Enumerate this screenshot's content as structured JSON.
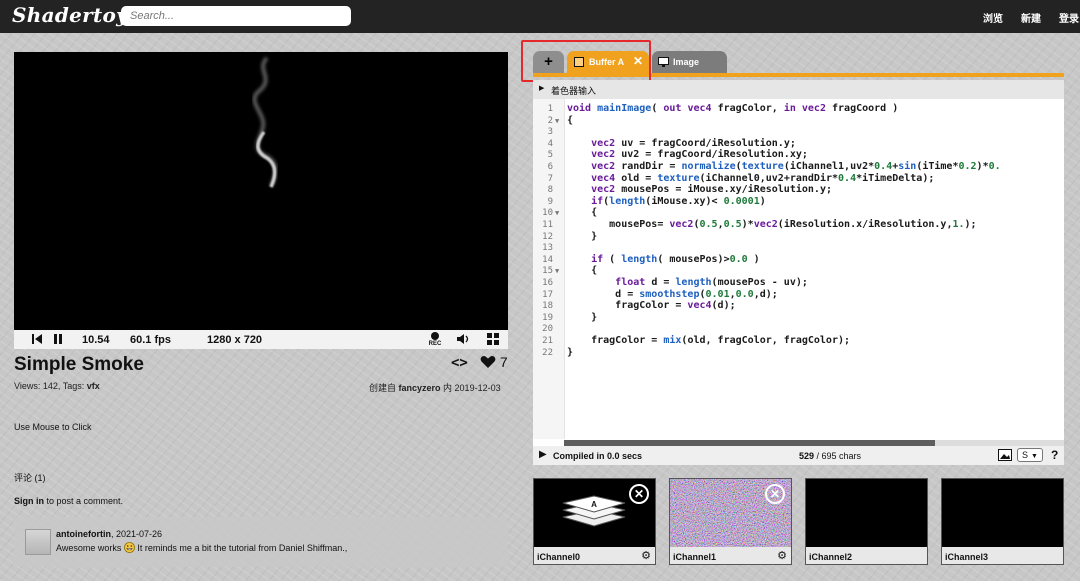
{
  "header": {
    "logo": "Shadertoy",
    "search_placeholder": "Search...",
    "nav": [
      "浏览",
      "新建",
      "登录"
    ]
  },
  "player": {
    "time": "10.54",
    "fps": "60.1 fps",
    "resolution": "1280 x 720",
    "rec_label": "REC"
  },
  "shader": {
    "title": "Simple Smoke",
    "views_text": "Views: 142, Tags: ",
    "tag": "vfx",
    "likes": "7",
    "created_prefix": "创建自 ",
    "author": "fancyzero",
    "created_suffix": " 内 2019-12-03",
    "description": "Use Mouse to Click"
  },
  "comments": {
    "header": "评论 (1)",
    "signin_link": "Sign in",
    "signin_text": " to post a comment.",
    "items": [
      {
        "user": "antoinefortin",
        "date": ", 2021-07-26",
        "text_before": "Awesome works ",
        "text_after": " It reminds me a bit the tutorial from Daniel Shiffman.,"
      }
    ]
  },
  "editor": {
    "tabs": [
      {
        "label": "+"
      },
      {
        "label": "Buffer A"
      },
      {
        "label": "Image"
      }
    ],
    "input_header": "着色器输入",
    "status": {
      "compiled": "Compiled in 0.0 secs",
      "chars_count": "529",
      "chars_total": " / 695 chars",
      "select_value": "S",
      "help": "?"
    }
  },
  "code_lines": [
    "void mainImage( out vec4 fragColor, in vec2 fragCoord )",
    "{",
    "",
    "    vec2 uv = fragCoord/iResolution.y;",
    "    vec2 uv2 = fragCoord/iResolution.xy;",
    "    vec2 randDir = normalize(texture(iChannel1,uv2*0.4+sin(iTime*0.2)*0.",
    "    vec4 old = texture(iChannel0,uv2+randDir*0.4*iTimeDelta);",
    "    vec2 mousePos = iMouse.xy/iResolution.y;",
    "    if(length(iMouse.xy)< 0.0001)",
    "    {",
    "       mousePos= vec2(0.5,0.5)*vec2(iResolution.x/iResolution.y,1.);",
    "    }",
    "",
    "    if ( length( mousePos)>0.0 )",
    "    {",
    "        float d = length(mousePos - uv);",
    "        d = smoothstep(0.01,0.0,d);",
    "        fragColor = vec4(d);",
    "    }",
    "",
    "    fragColor = mix(old, fragColor, fragColor);",
    "}"
  ],
  "channels": [
    {
      "label": "iChannel0"
    },
    {
      "label": "iChannel1"
    },
    {
      "label": "iChannel2"
    },
    {
      "label": "iChannel3"
    }
  ],
  "colors": {
    "accent": "#f0a11d",
    "highlight": "#e5292b",
    "topbar": "#232323"
  }
}
